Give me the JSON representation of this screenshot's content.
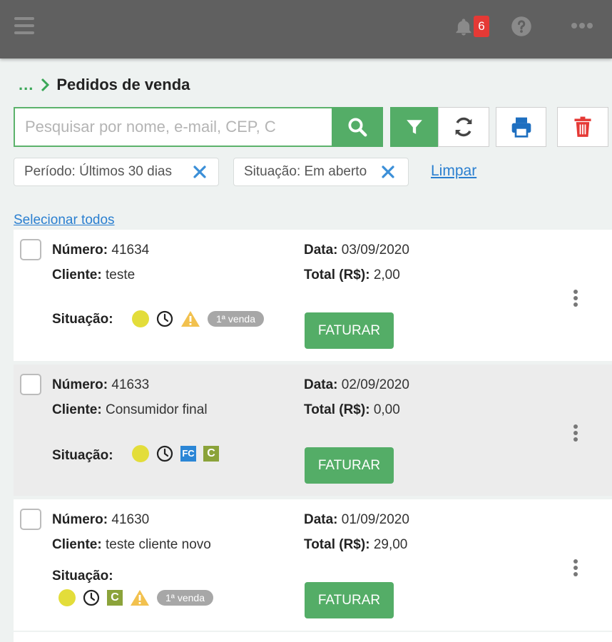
{
  "topbar": {
    "notifications_count": "6"
  },
  "breadcrumb": {
    "ellipsis": "...",
    "title": "Pedidos de venda"
  },
  "search": {
    "placeholder": "Pesquisar por nome, e-mail, CEP, C"
  },
  "filters": [
    {
      "label": "Período: Últimos 30 dias"
    },
    {
      "label": "Situação: Em aberto"
    }
  ],
  "clear_label": "Limpar",
  "select_all_label": "Selecionar todos",
  "labels": {
    "numero": "Número:",
    "cliente": "Cliente:",
    "situacao": "Situação:",
    "data": "Data:",
    "total": "Total (R$):",
    "faturar": "FATURAR"
  },
  "orders": [
    {
      "numero": "41634",
      "cliente": "teste",
      "data": "03/09/2020",
      "total": "2,00",
      "badge": "1ª venda",
      "icons": [
        "yellow-status-dot",
        "clock-icon",
        "warning-icon",
        "first-sale-badge"
      ]
    },
    {
      "numero": "41633",
      "cliente": "Consumidor final",
      "data": "02/09/2020",
      "total": "0,00",
      "icons": [
        "yellow-status-dot",
        "clock-icon",
        "fc-square-icon",
        "c-square-icon"
      ],
      "fc": "FC",
      "c": "C"
    },
    {
      "numero": "41630",
      "cliente": "teste cliente novo",
      "data": "01/09/2020",
      "total": "29,00",
      "badge": "1ª venda",
      "c": "C",
      "icons": [
        "yellow-status-dot",
        "clock-icon",
        "c-square-icon",
        "warning-icon",
        "first-sale-badge"
      ]
    }
  ],
  "colors": {
    "topbar": "#606060",
    "green": "#54ad67",
    "link": "#2a7fd0",
    "delete": "#e53935",
    "print": "#1e6fc0",
    "status_yellow": "#e3dd3a",
    "warning": "#f2c14e"
  }
}
